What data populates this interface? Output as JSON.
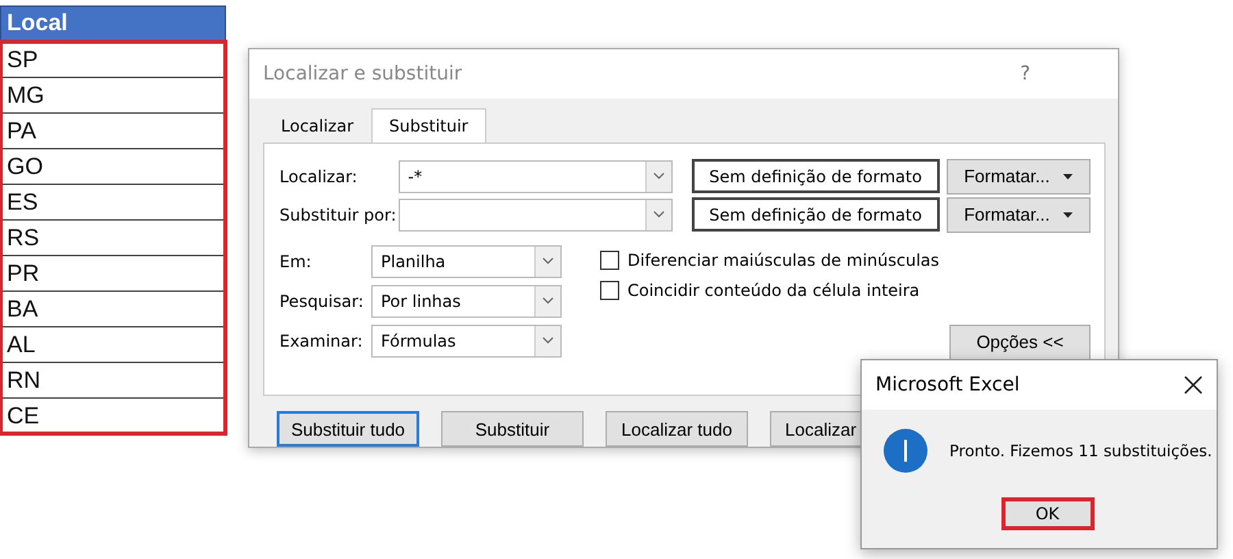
{
  "sheet": {
    "header": "Local",
    "highlighted": true,
    "rows": [
      "SP",
      "MG",
      "PA",
      "GO",
      "ES",
      "RS",
      "PR",
      "BA",
      "AL",
      "RN",
      "CE"
    ]
  },
  "dialog": {
    "title": "Localizar e substituir",
    "help": "?",
    "tabs": [
      {
        "label": "Localizar",
        "selected": false
      },
      {
        "label": "Substituir",
        "selected": true
      }
    ],
    "fields": [
      {
        "label": "Localizar:",
        "value": "-*",
        "format": "Sem definição de formato",
        "format_button": "Formatar..."
      },
      {
        "label": "Substituir por:",
        "format": "Sem definição de formato",
        "format_button": "Formatar..."
      }
    ],
    "options": [
      {
        "label": "Em:",
        "value": "Planilha"
      },
      {
        "label": "Pesquisar:",
        "value": "Por linhas"
      },
      {
        "label": "Examinar:",
        "value": "Fórmulas"
      }
    ],
    "checkboxes": [
      {
        "label": "Diferenciar maiúsculas de minúsculas",
        "checked": false
      },
      {
        "label": "Coincidir conteúdo da célula inteira",
        "checked": false
      }
    ],
    "options_button": "Opções <<",
    "buttons": [
      {
        "label": "Substituir tudo",
        "focused": true
      },
      {
        "label": "Substituir",
        "focused": false
      },
      {
        "label": "Localizar tudo",
        "focused": false
      },
      {
        "label": "Localizar",
        "focused": false
      }
    ]
  },
  "message": {
    "title": "Microsoft Excel",
    "text": "Pronto. Fizemos 11 substituições.",
    "button": "OK",
    "highlighted": true
  }
}
